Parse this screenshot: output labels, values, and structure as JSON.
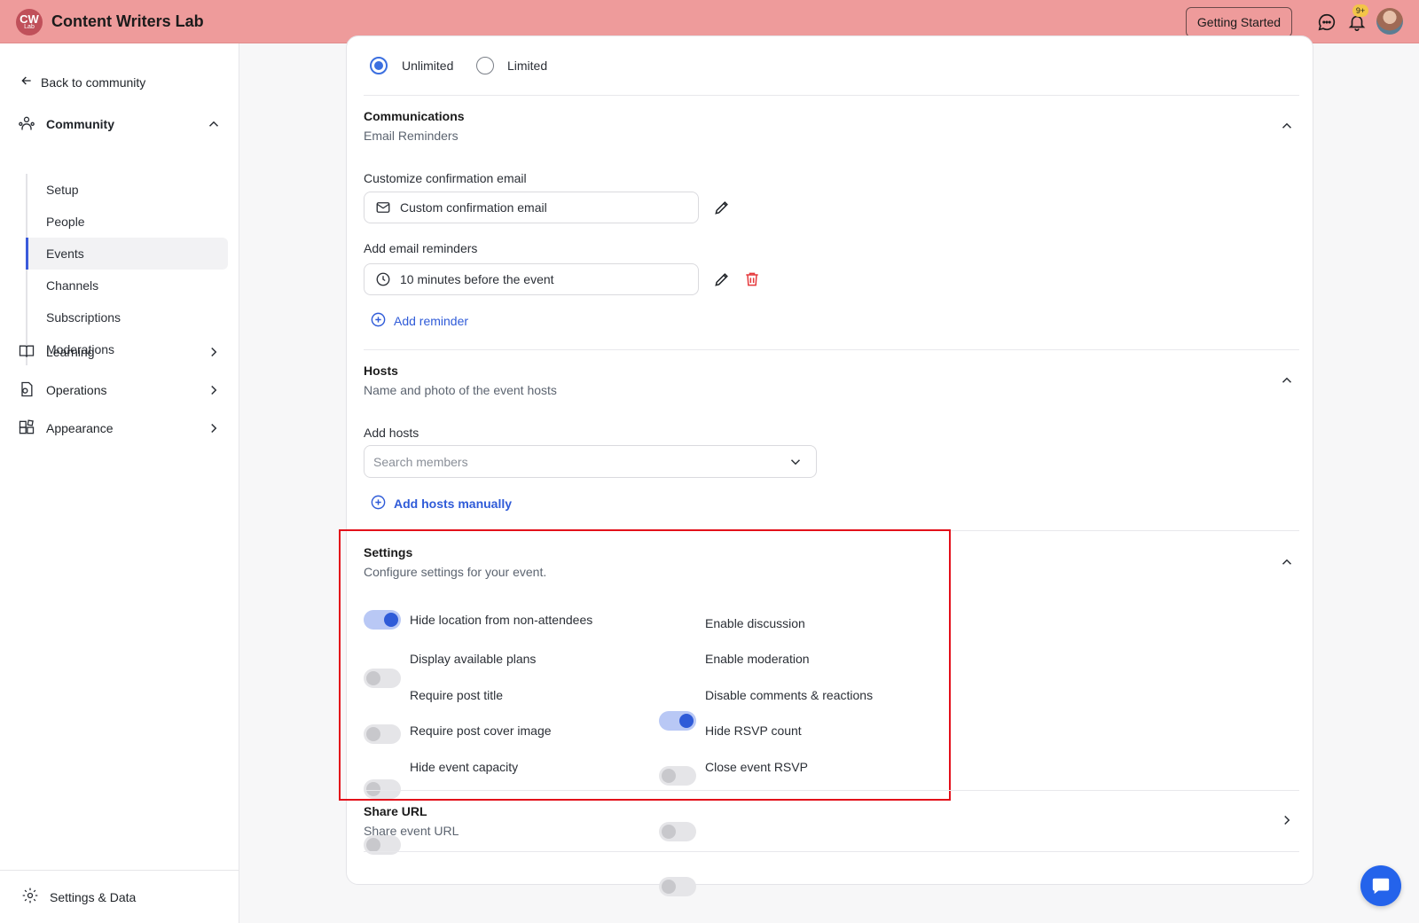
{
  "header": {
    "logo_text": "CW",
    "logo_sub": "Lab",
    "brand": "Content Writers Lab",
    "getting_started": "Getting Started",
    "notif_badge": "9+",
    "bg_color": "#ee9b9b"
  },
  "sidebar": {
    "back_label": "Back to community",
    "community_label": "Community",
    "community_items": [
      "Setup",
      "People",
      "Events",
      "Channels",
      "Subscriptions",
      "Moderations"
    ],
    "active_item": "Events",
    "learning_label": "Learning",
    "operations_label": "Operations",
    "appearance_label": "Appearance",
    "footer_label": "Settings & Data"
  },
  "capacity": {
    "options": [
      "Unlimited",
      "Limited"
    ],
    "selected": "Unlimited"
  },
  "communications": {
    "title": "Communications",
    "subtitle": "Email Reminders",
    "confirm_label": "Customize confirmation email",
    "confirm_value": "Custom confirmation email",
    "reminders_label": "Add email reminders",
    "reminder_value": "10 minutes before the event",
    "add_reminder": "Add reminder"
  },
  "hosts": {
    "title": "Hosts",
    "subtitle": "Name and photo of the event hosts",
    "add_label": "Add hosts",
    "search_placeholder": "Search members",
    "add_manual": "Add hosts manually"
  },
  "settings": {
    "title": "Settings",
    "subtitle": "Configure settings for your event.",
    "left": [
      {
        "label": "Hide location from non-attendees",
        "on": true
      },
      {
        "label": "Display available plans",
        "on": false
      },
      {
        "label": "Require post title",
        "on": false
      },
      {
        "label": "Require post cover image",
        "on": false
      },
      {
        "label": "Hide event capacity",
        "on": false
      }
    ],
    "right": [
      {
        "label": "Enable discussion",
        "on": true
      },
      {
        "label": "Enable moderation",
        "on": false
      },
      {
        "label": "Disable comments & reactions",
        "on": false
      },
      {
        "label": "Hide RSVP count",
        "on": false
      },
      {
        "label": "Close event RSVP",
        "on": false
      }
    ]
  },
  "share": {
    "title": "Share URL",
    "subtitle": "Share event URL"
  }
}
